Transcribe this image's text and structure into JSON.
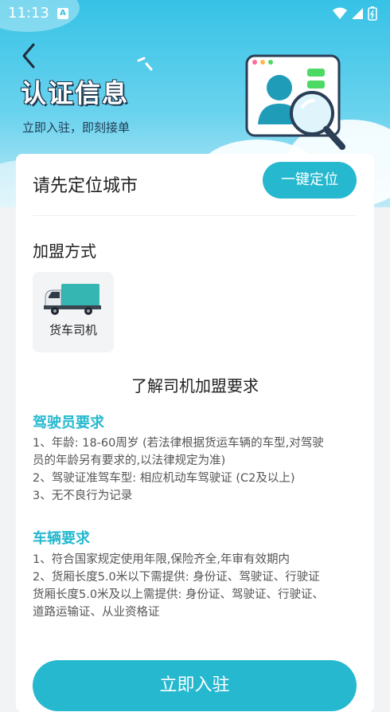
{
  "status_bar": {
    "time": "11:13",
    "notif_icon_letter": "A"
  },
  "header": {
    "title": "认证信息",
    "subtitle": "立即入驻，即刻接单"
  },
  "location": {
    "title": "请先定位城市",
    "button_label": "一键定位"
  },
  "join": {
    "title": "加盟方式",
    "options": [
      {
        "label": "货车司机",
        "icon": "truck-icon"
      }
    ]
  },
  "requirements": {
    "heading": "了解司机加盟要求",
    "driver": {
      "title": "驾驶员要求",
      "lines": [
        "1、年龄: 18-60周岁 (若法律根据货运车辆的车型,对驾驶",
        "员的年龄另有要求的,以法律规定为准)",
        "2、驾驶证准驾车型: 相应机动车驾驶证 (C2及以上)",
        "3、无不良行为记录"
      ]
    },
    "vehicle": {
      "title": "车辆要求",
      "lines": [
        "1、符合国家规定使用年限,保险齐全,年审有效期内",
        "2、货厢长度5.0米以下需提供: 身份证、驾驶证、行驶证",
        "货厢长度5.0米及以上需提供: 身份证、驾驶证、行驶证、",
        "道路运输证、从业资格证"
      ]
    }
  },
  "submit_label": "立即入驻",
  "colors": {
    "accent": "#26b8cf",
    "hero_top": "#36c2e6"
  }
}
